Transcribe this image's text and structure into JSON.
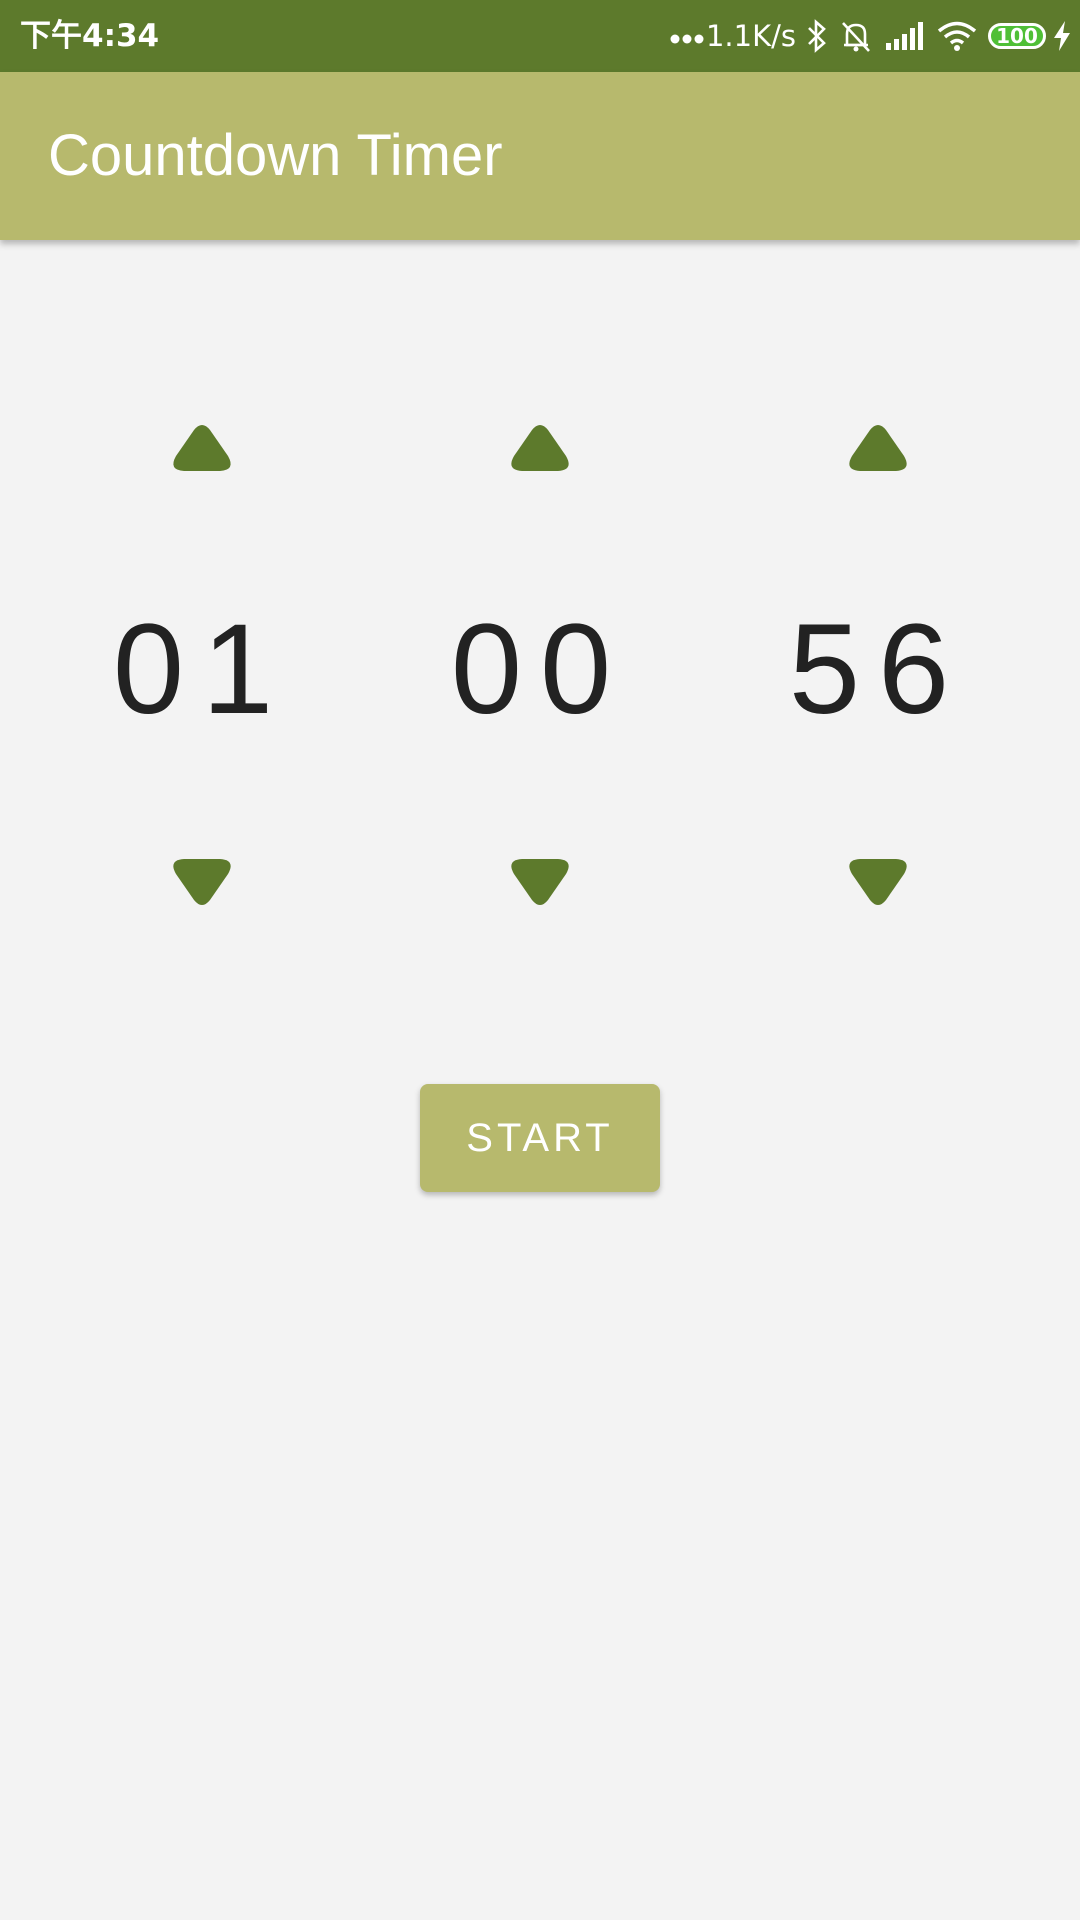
{
  "status_bar": {
    "time": "下午4:34",
    "net_speed": "1.1K/s",
    "battery": "100",
    "icons": [
      "dots-icon",
      "bluetooth-icon",
      "alarm-off-icon",
      "signal-icon",
      "wifi-icon",
      "battery-icon",
      "charging-icon"
    ]
  },
  "app_bar": {
    "title": "Countdown Timer"
  },
  "timer": {
    "hours": "01",
    "minutes": "00",
    "seconds": "56"
  },
  "start_label": "START",
  "colors": {
    "status_bar": "#5d7a2c",
    "primary": "#b7b96d",
    "arrow": "#5d7a2c",
    "background": "#f3f3f3",
    "digits": "#222222"
  }
}
